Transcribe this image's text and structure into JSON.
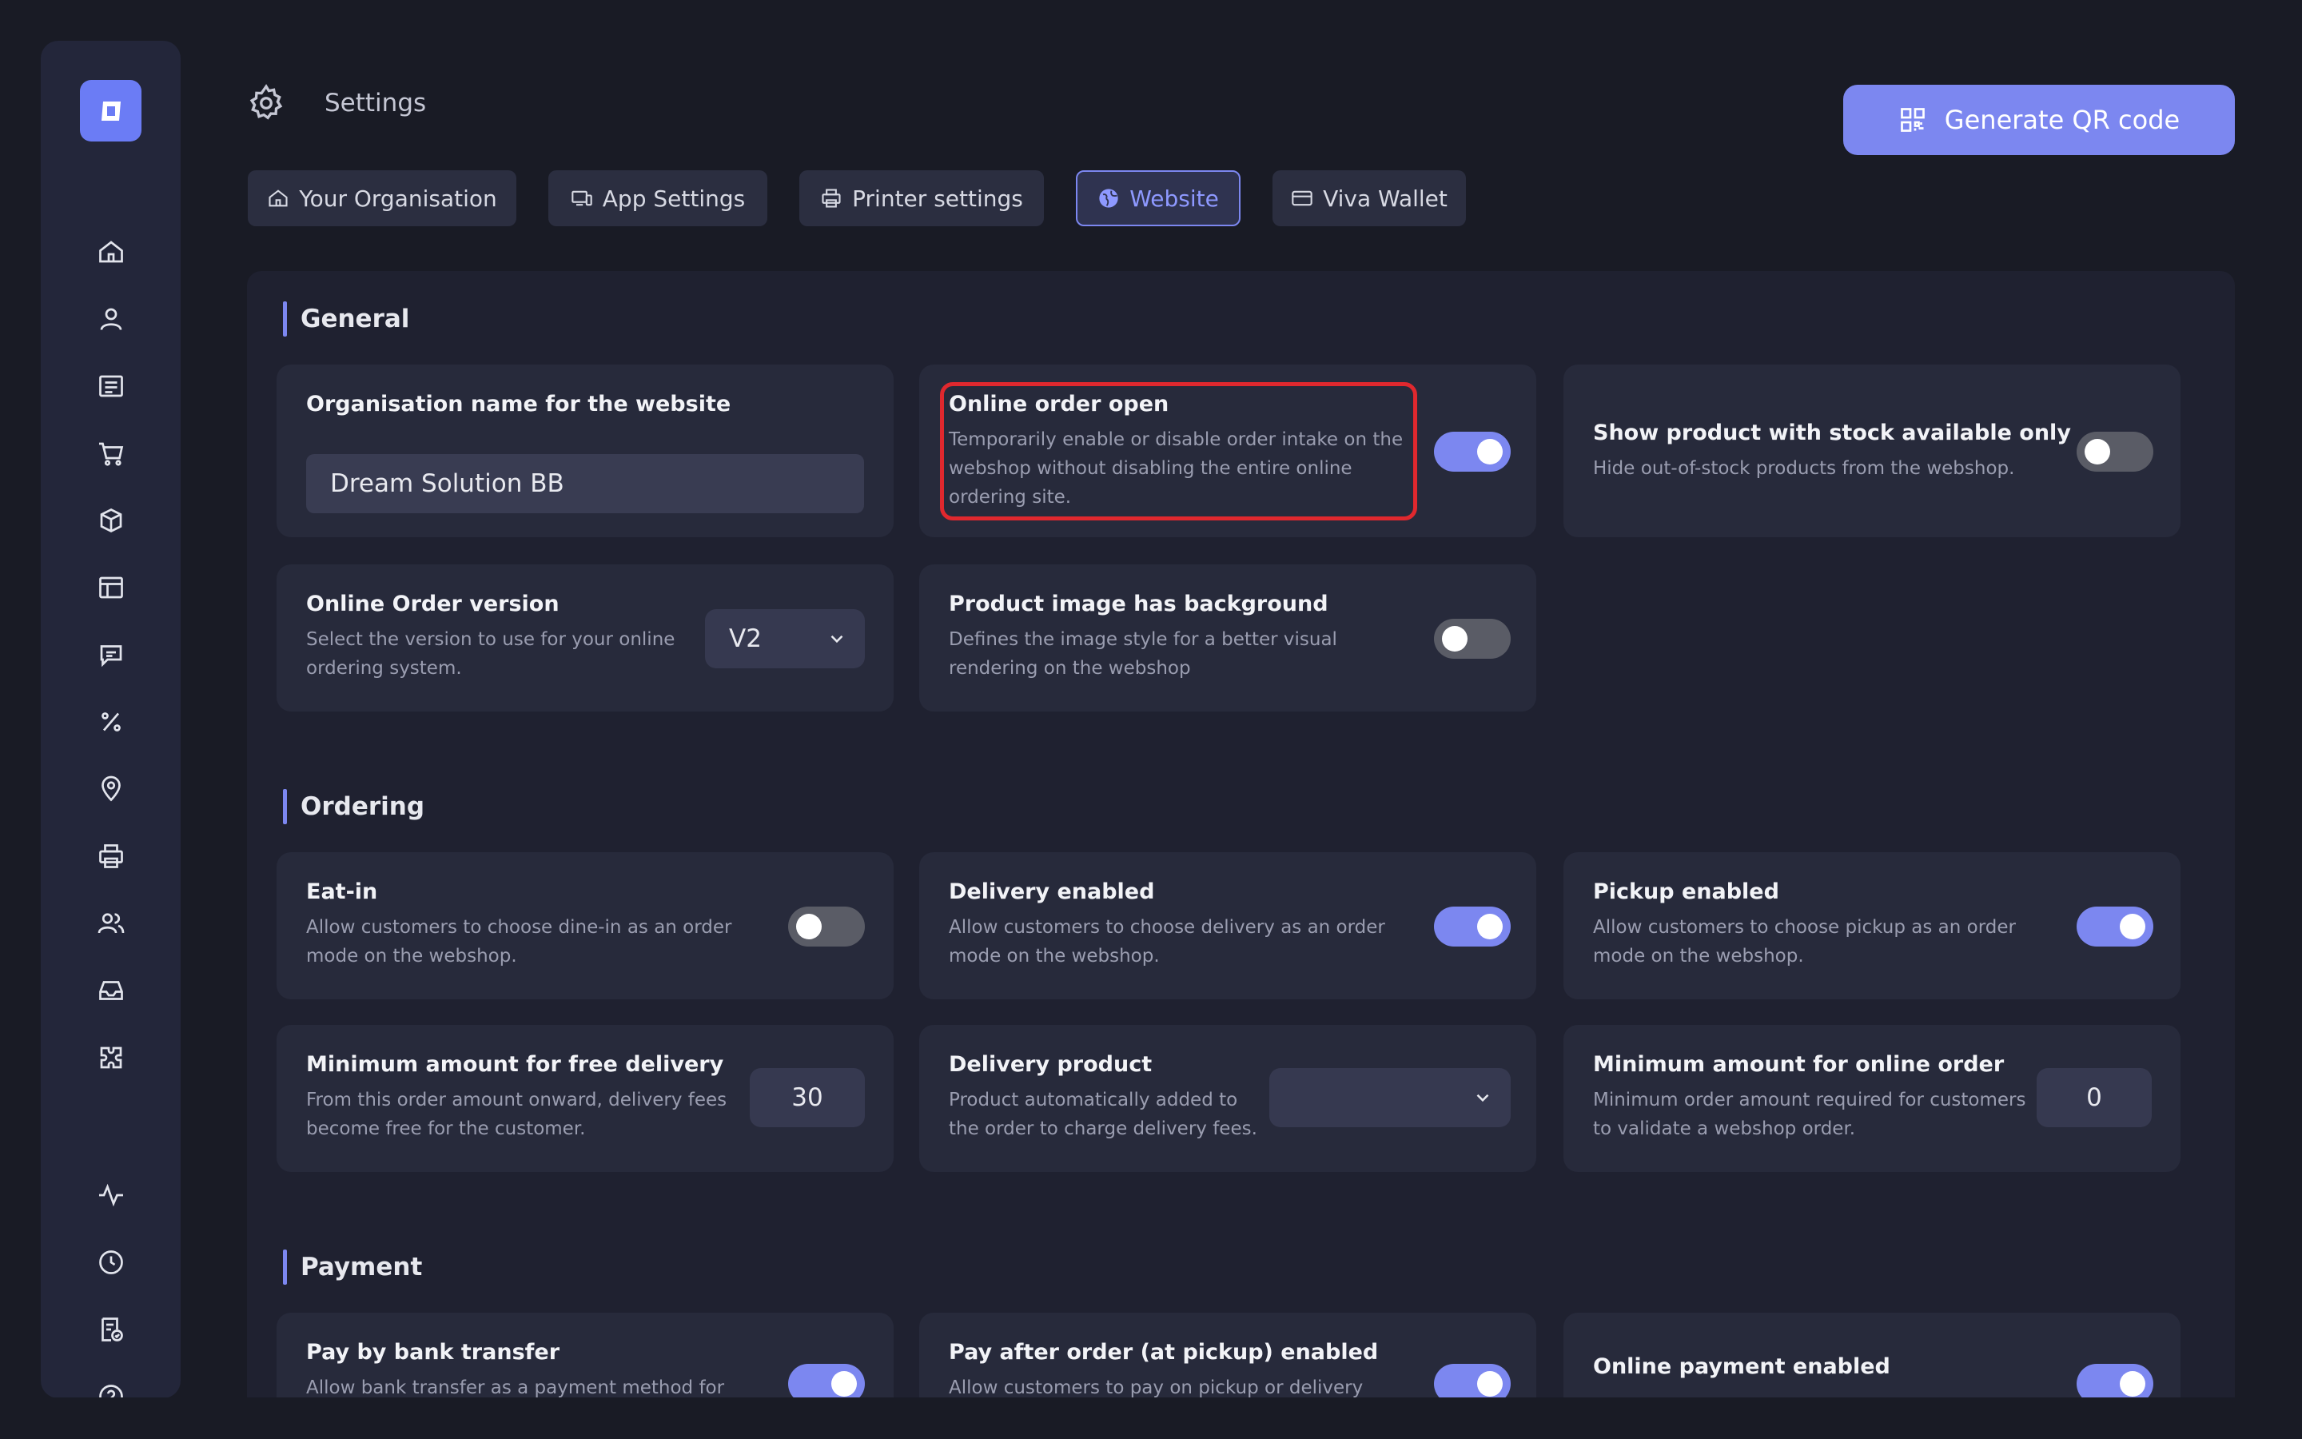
{
  "header": {
    "title": "Settings",
    "qr_button_label": "Generate QR code"
  },
  "tabs": [
    {
      "label": "Your Organisation",
      "icon": "home-icon"
    },
    {
      "label": "App Settings",
      "icon": "devices-icon"
    },
    {
      "label": "Printer settings",
      "icon": "printer-icon"
    },
    {
      "label": "Website",
      "icon": "globe-icon",
      "active": true
    },
    {
      "label": "Viva Wallet",
      "icon": "card-icon"
    }
  ],
  "sidebar": {
    "icons": [
      "home-icon",
      "user-icon",
      "orders-icon",
      "cart-icon",
      "box-icon",
      "table-icon",
      "chat-icon",
      "percent-icon",
      "location-icon",
      "printer-icon",
      "users-icon",
      "inbox-icon",
      "puzzle-icon",
      "activity-icon",
      "clock-icon",
      "report-icon",
      "help-icon"
    ]
  },
  "general": {
    "title": "General",
    "org_name": {
      "title": "Organisation name for the website",
      "value": "Dream Solution BB"
    },
    "online_order_open": {
      "title": "Online order open",
      "desc1": "Temporarily enable or disable order intake on the",
      "desc2": "webshop without disabling the entire online",
      "desc3": "ordering site.",
      "enabled": true
    },
    "stock_only": {
      "title": "Show product with stock available only",
      "desc1": "Hide out-of-stock products from the webshop.",
      "enabled": false
    },
    "order_version": {
      "title": "Online Order version",
      "desc1": "Select the version to use for your online",
      "desc2": "ordering system.",
      "value": "V2"
    },
    "image_background": {
      "title": "Product image has background",
      "desc1": "Defines the image style for a better visual",
      "desc2": "rendering on the webshop",
      "enabled": false
    }
  },
  "ordering": {
    "title": "Ordering",
    "eat_in": {
      "title": "Eat-in",
      "desc1": "Allow customers to choose dine-in as an order",
      "desc2": "mode on the webshop.",
      "enabled": false
    },
    "delivery": {
      "title": "Delivery enabled",
      "desc1": "Allow customers to choose delivery as an order",
      "desc2": "mode on the webshop.",
      "enabled": true
    },
    "pickup": {
      "title": "Pickup enabled",
      "desc1": "Allow customers to choose pickup as an order",
      "desc2": "mode on the webshop.",
      "enabled": true
    },
    "free_delivery": {
      "title": "Minimum amount for free delivery",
      "desc1": "From this order amount onward, delivery fees",
      "desc2": "become free for the customer.",
      "value": "30"
    },
    "delivery_product": {
      "title": "Delivery product",
      "desc1": "Product automatically added to",
      "desc2": "the order to charge delivery fees.",
      "value": ""
    },
    "min_online": {
      "title": "Minimum amount for online order",
      "desc1": "Minimum order amount required for customers",
      "desc2": "to validate a webshop order.",
      "value": "0"
    }
  },
  "payment": {
    "title": "Payment",
    "bank_transfer": {
      "title": "Pay by bank transfer",
      "desc1": "Allow bank transfer as a payment method for",
      "enabled": true
    },
    "pay_after": {
      "title": "Pay after order (at pickup) enabled",
      "desc1": "Allow customers to pay on pickup or delivery",
      "enabled": true
    },
    "online_payment": {
      "title": "Online payment enabled",
      "enabled": true
    }
  },
  "colors": {
    "accent": "#7c87f0",
    "highlight": "#e0282e",
    "background": "#191b25",
    "card": "#272a3b"
  }
}
